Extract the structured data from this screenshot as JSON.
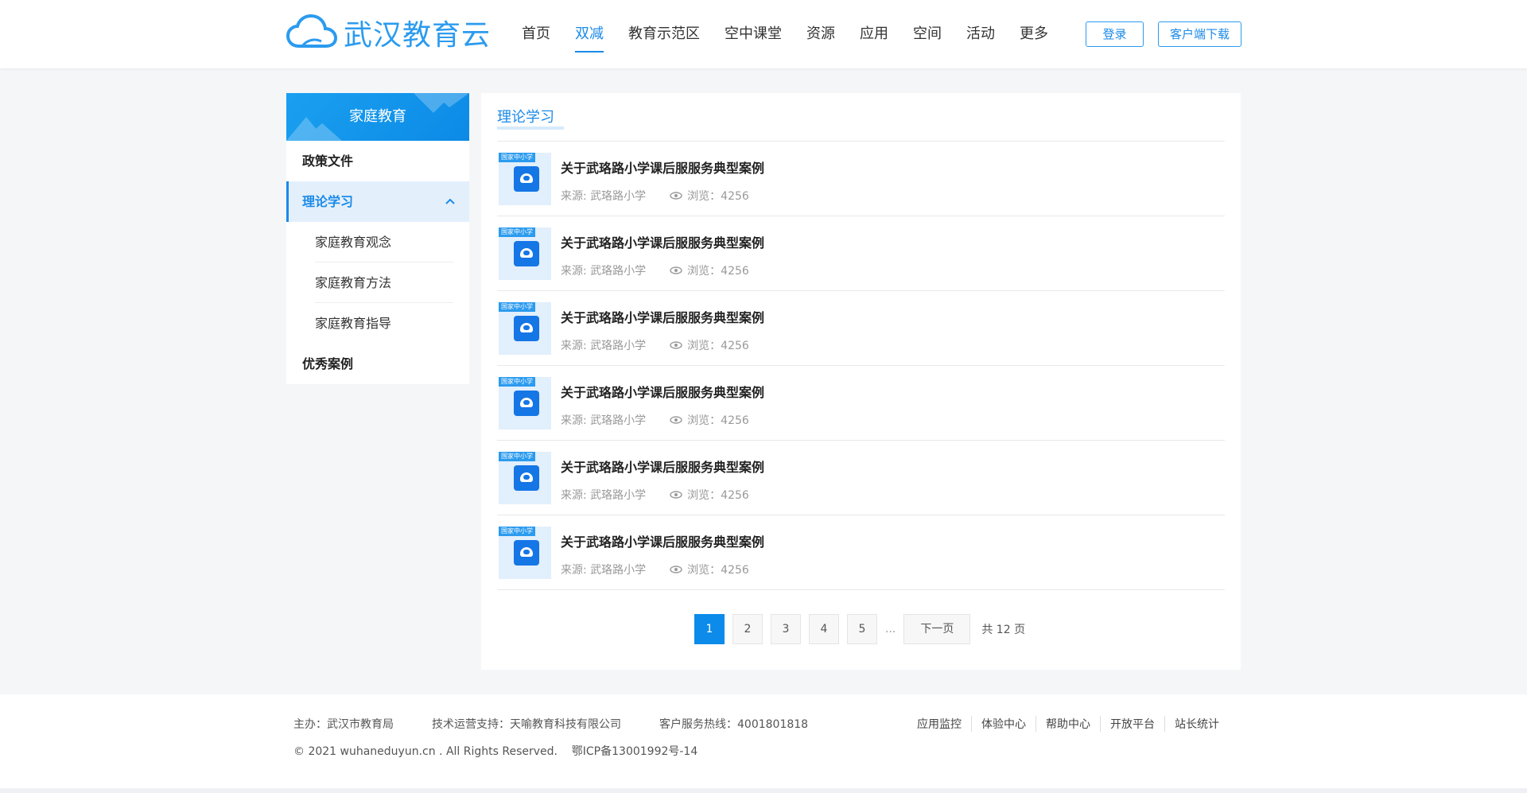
{
  "header": {
    "logo_text": "武汉教育云",
    "nav": [
      "首页",
      "双减",
      "教育示范区",
      "空中课堂",
      "资源",
      "应用",
      "空间",
      "活动",
      "更多"
    ],
    "active_nav": "双减",
    "login_label": "登录",
    "download_label": "客户端下载"
  },
  "sidebar": {
    "title": "家庭教育",
    "items": [
      {
        "label": "政策文件"
      },
      {
        "label": "理论学习"
      },
      {
        "label": "优秀案例"
      }
    ],
    "subitems": [
      "家庭教育观念",
      "家庭教育方法",
      "家庭教育指导"
    ]
  },
  "main": {
    "title": "理论学习",
    "thumb_tag": "国家中小学",
    "list": [
      {
        "title": "关于武珞路小学课后服服务典型案例",
        "source": "来源: 武珞路小学",
        "views": "浏览：4256"
      },
      {
        "title": "关于武珞路小学课后服服务典型案例",
        "source": "来源: 武珞路小学",
        "views": "浏览：4256"
      },
      {
        "title": "关于武珞路小学课后服服务典型案例",
        "source": "来源: 武珞路小学",
        "views": "浏览：4256"
      },
      {
        "title": "关于武珞路小学课后服服务典型案例",
        "source": "来源: 武珞路小学",
        "views": "浏览：4256"
      },
      {
        "title": "关于武珞路小学课后服服务典型案例",
        "source": "来源: 武珞路小学",
        "views": "浏览：4256"
      },
      {
        "title": "关于武珞路小学课后服服务典型案例",
        "source": "来源: 武珞路小学",
        "views": "浏览：4256"
      }
    ],
    "pager": {
      "pages": [
        "1",
        "2",
        "3",
        "4",
        "5"
      ],
      "current": "1",
      "ellipsis": "...",
      "next_label": "下一页",
      "total_label": "共 12 页"
    }
  },
  "footer": {
    "host": "主办：武汉市教育局",
    "support": "技术运营支持：天喻教育科技有限公司",
    "hotline": "客户服务热线：4001801818",
    "copyright": "© 2021 wuhaneduyun.cn . All Rights Reserved.    鄂ICP备13001992号-14",
    "links": [
      "应用监控",
      "体验中心",
      "帮助中心",
      "开放平台",
      "站长统计"
    ]
  },
  "colors": {
    "accent": "#1b8ae8",
    "sidebar_active_bg": "#e3f0fc"
  },
  "icons": {
    "logo": "cloud-icon",
    "expand": "chevron-up-icon",
    "views": "eye-icon"
  }
}
